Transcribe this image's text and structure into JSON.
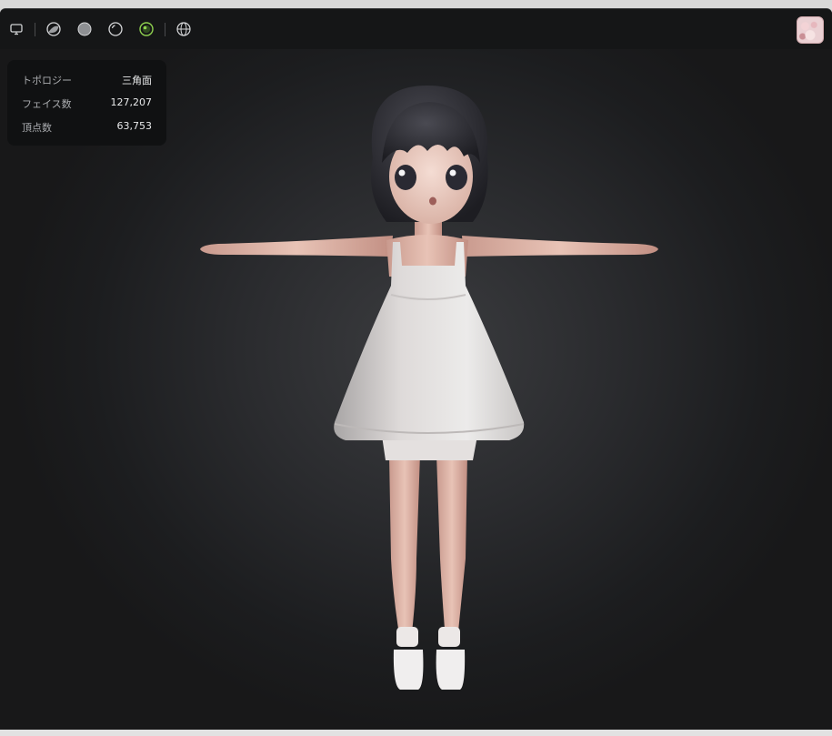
{
  "toolbar": {
    "icons": [
      "monitor-icon",
      "material-sphere-icon",
      "solid-sphere-icon",
      "outline-sphere-icon",
      "textured-sphere-icon",
      "wireframe-globe-icon"
    ],
    "active_color": "#8fd14f"
  },
  "stats": {
    "rows": [
      {
        "label": "トポロジー",
        "value": "三角面"
      },
      {
        "label": "フェイス数",
        "value": "127,207"
      },
      {
        "label": "頂点数",
        "value": "63,753"
      }
    ]
  }
}
